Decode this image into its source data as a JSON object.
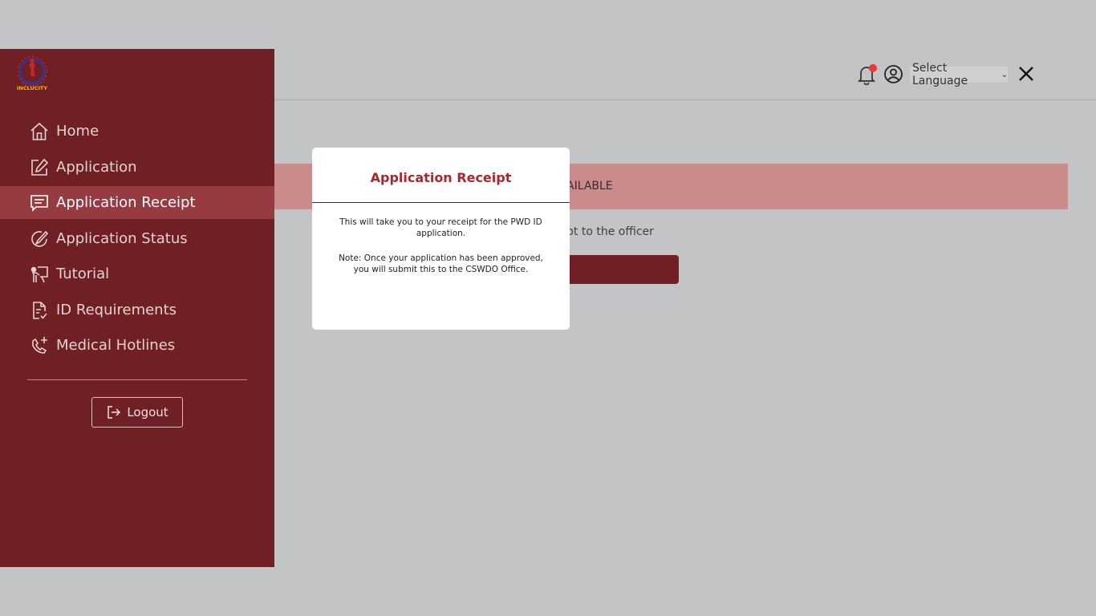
{
  "sidebar": {
    "logo_text": "INCLUCITY",
    "items": [
      {
        "label": "Home",
        "icon": "home-icon"
      },
      {
        "label": "Application",
        "icon": "edit-icon"
      },
      {
        "label": "Application Receipt",
        "icon": "receipt-icon"
      },
      {
        "label": "Application Status",
        "icon": "status-icon"
      },
      {
        "label": "Tutorial",
        "icon": "tutorial-icon"
      },
      {
        "label": "ID Requirements",
        "icon": "document-check-icon"
      },
      {
        "label": "Medical Hotlines",
        "icon": "phone-plus-icon"
      }
    ],
    "active_item": "Application Receipt",
    "logout_label": "Logout"
  },
  "header": {
    "language_label": "Select Language",
    "notification_dot": true
  },
  "main": {
    "banner_text": "AILABLE",
    "instruction_text": "pt to the officer"
  },
  "modal": {
    "title": "Application Receipt",
    "body": "This will take you to your receipt for the PWD ID application.",
    "note": "Note: Once your application has been approved, you will submit this to the CSWDO Office."
  },
  "colors": {
    "sidebar": "#701f24",
    "active": "#953b41",
    "banner": "#c98b8b",
    "title": "#a8282c",
    "background": "#c3c4c6"
  }
}
